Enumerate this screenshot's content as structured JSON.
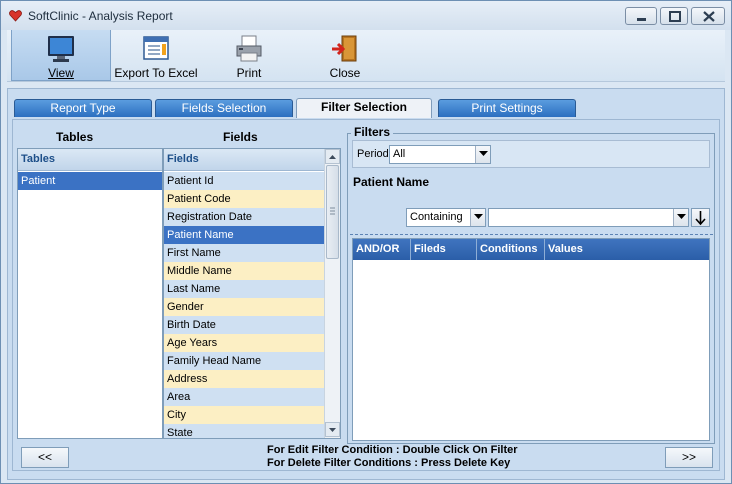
{
  "window": {
    "title": "SoftClinic - Analysis Report"
  },
  "toolbar": {
    "view_label": "View",
    "export_label": "Export To Excel",
    "print_label": "Print",
    "close_label": "Close"
  },
  "tabs": [
    {
      "label": "Report Type",
      "active": false
    },
    {
      "label": "Fields Selection",
      "active": false
    },
    {
      "label": "Filter Selection",
      "active": true
    },
    {
      "label": "Print Settings",
      "active": false
    }
  ],
  "tables_panel": {
    "heading": "Tables",
    "list_header": "Tables",
    "items": [
      "Patient"
    ]
  },
  "fields_panel": {
    "heading": "Fields",
    "list_header": "Fields",
    "items": [
      "Patient Id",
      "Patient Code",
      "Registration Date",
      "Patient Name",
      "First Name",
      "Middle Name",
      "Last Name",
      "Gender",
      "Birth Date",
      "Age Years",
      "Family Head Name",
      "Address",
      "Area",
      "City",
      "State"
    ],
    "selected": "Patient Name"
  },
  "filters": {
    "title": "Filters",
    "period_label": "Period",
    "period_value": "All",
    "field_name": "Patient Name",
    "condition_value": "Containing",
    "value_input": "",
    "grid_columns": [
      "AND/OR",
      "Fileds",
      "Conditions",
      "Values"
    ]
  },
  "footer": {
    "prev_label": "<<",
    "next_label": ">>",
    "hint_edit": "For Edit Filter Condition : Double Click On Filter",
    "hint_delete": "For Delete Filter Conditions : Press Delete Key"
  },
  "colors": {
    "tab_blue": "#2c6fc0",
    "selected_row": "#3b72c4",
    "row_blue": "#cfe0f2",
    "row_yellow": "#fcefc4"
  }
}
